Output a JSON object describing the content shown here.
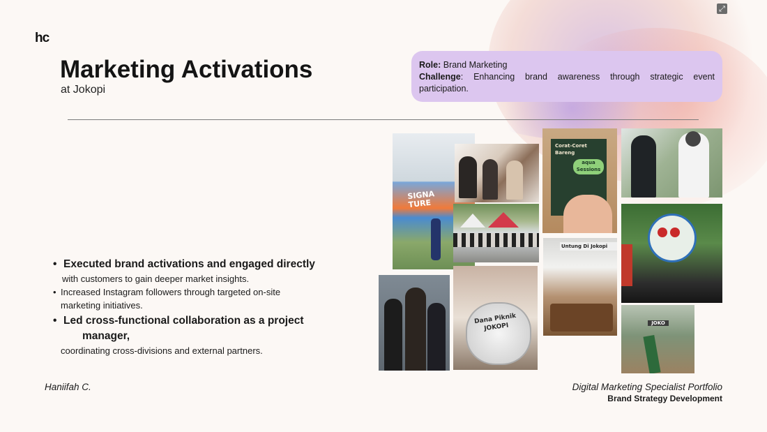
{
  "logo": "hc",
  "title": "Marketing Activations",
  "subtitle": "at Jokopi",
  "role": {
    "role_label": "Role:",
    "role_value": "Brand Marketing",
    "challenge_label": "Challenge",
    "challenge_value": ": Enhancing brand awareness through strategic event participation."
  },
  "bullets": [
    {
      "lead": "Executed brand activations and engaged directly",
      "cont": "with customers to gain deeper market insights."
    },
    {
      "lead": "Increased Instagram followers through targeted on-site",
      "cont": "marketing initiatives."
    },
    {
      "lead": "Led cross-functional collaboration as a project",
      "lead2": "manager,",
      "cont": "coordinating cross-divisions and external partners."
    }
  ],
  "footer": {
    "author": "Haniifah C.",
    "portfolio": "Digital Marketing Specialist Portfolio",
    "section": "Brand Strategy Development"
  },
  "photos": {
    "signa_text": "SIGNA TURE",
    "corat_text": "Corat-Coret Bareng",
    "aqua_text": "aqua Sessions",
    "untung_text": "Untung Di Jokopi",
    "dana_text": "Dana Piknik JOKOPI",
    "jokopi_text": "JOKO"
  },
  "icons": {
    "expand": "expand-icon",
    "bullet": "bullet-icon"
  }
}
